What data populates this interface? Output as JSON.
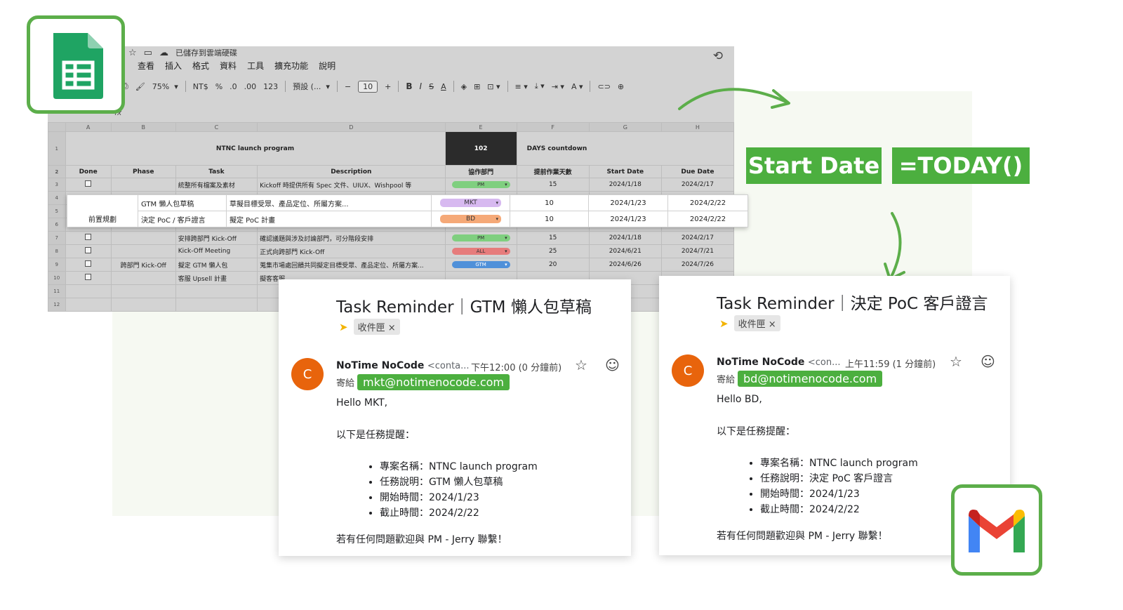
{
  "sheet": {
    "save_status": "已儲存到雲端硬碟",
    "menu": [
      "查看",
      "插入",
      "格式",
      "資料",
      "工具",
      "擴充功能",
      "說明"
    ],
    "toolbar": {
      "zoom": "75%",
      "currency": "NT$",
      "percent": "%",
      "dec_minus": ".0",
      "dec_plus": ".00",
      "num_format": "123",
      "font": "預設 (...",
      "minus": "−",
      "font_size": "10",
      "plus": "+",
      "bold": "B",
      "italic": "I",
      "strike": "S"
    },
    "fx": "fx",
    "columns": [
      "A",
      "B",
      "C",
      "D",
      "E",
      "F",
      "G",
      "H"
    ],
    "title": "NTNC launch program",
    "days": "102",
    "days_label": "DAYS countdown",
    "headers": [
      "Done",
      "Phase",
      "Task",
      "Description",
      "協作部門",
      "提前作業天數",
      "Start Date",
      "Due Date"
    ],
    "rows": [
      {
        "n": "3",
        "task": "統整所有檔案及素材",
        "desc": "Kickoff 時提供所有 Spec 文件、UIUX、Wishpool 等",
        "dept": "PM",
        "days": "15",
        "start": "2024/1/18",
        "due": "2024/2/17"
      },
      {
        "n": "7",
        "task": "安排跨部門 Kick-Off",
        "desc": "確認議題與涉及討論部門，可分階段安排",
        "dept": "PM",
        "days": "15",
        "start": "2024/1/18",
        "due": "2024/2/17"
      },
      {
        "n": "8",
        "task": "Kick-Off Meeting",
        "desc": "正式向跨部門 Kick-Off",
        "dept": "ALL",
        "days": "25",
        "start": "2024/6/21",
        "due": "2024/7/21"
      },
      {
        "n": "9",
        "task": "擬定 GTM 懶人包",
        "desc": "蒐集市場處回饋共同擬定目標受眾、產品定位、所屬方案...",
        "dept": "GTM",
        "days": "20",
        "start": "2024/6/26",
        "due": "2024/7/26"
      },
      {
        "n": "10",
        "task": "客服 Upsell 計畫",
        "desc": "擬客客服...",
        "dept": "",
        "days": "",
        "start": "",
        "due": ""
      }
    ],
    "phase_kickoff": "跨部門 Kick-Off",
    "highlight": {
      "phase": "前置規劃",
      "rows": [
        {
          "task": "GTM 懶人包草稿",
          "desc": "草擬目標受眾、產品定位、所屬方案...",
          "dept": "MKT",
          "days": "10",
          "start": "2024/1/23",
          "due": "2024/2/22"
        },
        {
          "task": "決定 PoC / 客戶證言",
          "desc": "擬定 PoC 計畫",
          "dept": "BD",
          "days": "10",
          "start": "2024/1/23",
          "due": "2024/2/22"
        }
      ]
    }
  },
  "tags": {
    "start_date": "Start Date",
    "today": "=TODAY()"
  },
  "email_mkt": {
    "subject": "Task Reminder｜GTM 懶人包草稿",
    "inbox": "收件匣 ×",
    "avatar": "C",
    "sender": "NoTime NoCode",
    "sender_addr": "<conta...",
    "time": "下午12:00 (0 分鐘前)",
    "to_label": "寄給",
    "to": "mkt@notimenocode.com",
    "greeting": "Hello MKT,",
    "intro": "以下是任務提醒：",
    "items": [
      "專案名稱：NTNC launch program",
      "任務說明：GTM 懶人包草稿",
      "開始時間：2024/1/23",
      "截止時間：2024/2/22"
    ],
    "footer": "若有任何問題歡迎與 PM - Jerry 聯繫！"
  },
  "email_bd": {
    "subject": "Task Reminder｜決定 PoC 客戶證言",
    "inbox": "收件匣 ×",
    "avatar": "C",
    "sender": "NoTime NoCode",
    "sender_addr": "<con...",
    "time": "上午11:59 (1 分鐘前)",
    "to_label": "寄給",
    "to": "bd@notimenocode.com",
    "greeting": "Hello BD,",
    "intro": "以下是任務提醒：",
    "items": [
      "專案名稱：NTNC launch program",
      "任務說明：決定 PoC 客戶證言",
      "開始時間：2024/1/23",
      "截止時間：2024/2/22"
    ],
    "footer": "若有任何問題歡迎與 PM - Jerry 聯繫！"
  },
  "colors": {
    "accent_green": "#4caf3f",
    "logo_border": "#5cae4a",
    "avatar": "#e8640c"
  }
}
